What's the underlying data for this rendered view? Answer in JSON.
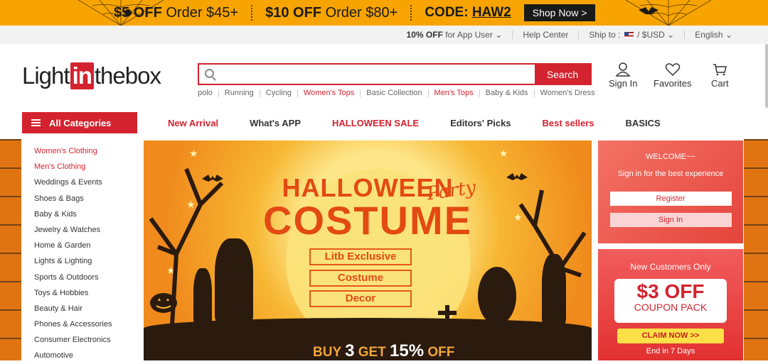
{
  "promo": {
    "offer1_amount": "$5 OFF",
    "offer1_cond": "Order $45+",
    "offer2_amount": "$10 OFF",
    "offer2_cond": "Order $80+",
    "code_label": "CODE:",
    "code": "HAW2",
    "shop_now": "Shop Now >"
  },
  "util": {
    "app_bold": "10% OFF",
    "app_rest": "for App User",
    "help": "Help Center",
    "ship_to": "Ship to :",
    "currency": "/ $USD",
    "language": "English"
  },
  "header": {
    "logo_light": "Light",
    "logo_in": "in",
    "logo_thebox": "thebox",
    "search_placeholder": "",
    "search_button": "Search",
    "hot_searches": [
      {
        "label": "polo",
        "highlight": false
      },
      {
        "label": "Running",
        "highlight": false
      },
      {
        "label": "Cycling",
        "highlight": false
      },
      {
        "label": "Women's Tops",
        "highlight": true
      },
      {
        "label": "Basic Collection",
        "highlight": false
      },
      {
        "label": "Men's Tops",
        "highlight": true
      },
      {
        "label": "Baby & Kids",
        "highlight": false
      },
      {
        "label": "Women's Dress",
        "highlight": false
      }
    ],
    "sign_in": "Sign In",
    "favorites": "Favorites",
    "cart": "Cart"
  },
  "nav": {
    "all_categories": "All Categories",
    "items": [
      "New Arrival",
      "What's APP",
      "HALLOWEEN SALE",
      "Editors' Picks",
      "Best sellers",
      "BASICS"
    ]
  },
  "categories": [
    "Women's Clothing",
    "Men's Clothing",
    "Weddings & Events",
    "Shoes & Bags",
    "Baby & Kids",
    "Jewelry & Watches",
    "Home & Garden",
    "Lights & Lighting",
    "Sports & Outdoors",
    "Toys & Hobbies",
    "Beauty & Hair",
    "Phones & Accessories",
    "Consumer Electronics",
    "Automotive"
  ],
  "banner": {
    "title1": "HALLOWEEN",
    "party": "Party",
    "title2": "COSTUME",
    "boxes": [
      "Litb Exclusive",
      "Costume",
      "Decor"
    ],
    "offer_buy": "BUY",
    "offer_n1": "3",
    "offer_get": "GET",
    "offer_n2": "15%",
    "offer_off": "OFF"
  },
  "welcome": {
    "title": "WELCOME~~",
    "subtitle": "Sign in for the best experience",
    "register": "Register",
    "sign_in": "Sign In"
  },
  "coupon": {
    "title": "New Customers Only",
    "amount": "$3 OFF",
    "label": "COUPON PACK",
    "claim": "CLAIM NOW >>",
    "end": "End in 7 Days"
  },
  "colors": {
    "brand_red": "#d3232f",
    "promo_orange": "#f7a400"
  }
}
